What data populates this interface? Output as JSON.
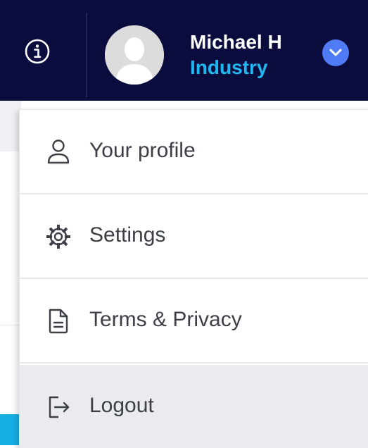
{
  "header": {
    "user": {
      "name": "Michael H",
      "role": "Industry"
    },
    "colors": {
      "background": "#0b0c3e",
      "role_text": "#20b8f0",
      "toggle": "#4f7bf4"
    },
    "icons": {
      "info": "info-icon",
      "avatar": "avatar-placeholder",
      "toggle": "chevron-down-icon"
    }
  },
  "menu": {
    "items": [
      {
        "label": "Your profile",
        "icon": "user-icon"
      },
      {
        "label": "Settings",
        "icon": "gear-icon"
      },
      {
        "label": "Terms & Privacy",
        "icon": "document-icon"
      },
      {
        "label": "Logout",
        "icon": "logout-icon",
        "highlighted": true
      }
    ]
  }
}
